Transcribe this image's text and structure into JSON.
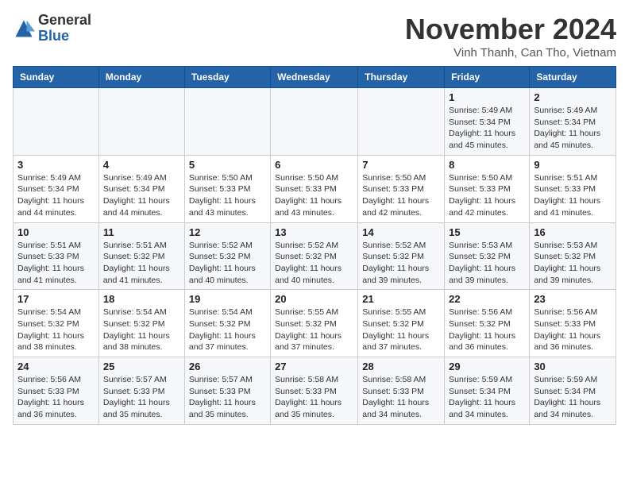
{
  "header": {
    "logo_general": "General",
    "logo_blue": "Blue",
    "month_title": "November 2024",
    "location": "Vinh Thanh, Can Tho, Vietnam"
  },
  "weekdays": [
    "Sunday",
    "Monday",
    "Tuesday",
    "Wednesday",
    "Thursday",
    "Friday",
    "Saturday"
  ],
  "weeks": [
    [
      {
        "day": "",
        "info": ""
      },
      {
        "day": "",
        "info": ""
      },
      {
        "day": "",
        "info": ""
      },
      {
        "day": "",
        "info": ""
      },
      {
        "day": "",
        "info": ""
      },
      {
        "day": "1",
        "info": "Sunrise: 5:49 AM\nSunset: 5:34 PM\nDaylight: 11 hours and 45 minutes."
      },
      {
        "day": "2",
        "info": "Sunrise: 5:49 AM\nSunset: 5:34 PM\nDaylight: 11 hours and 45 minutes."
      }
    ],
    [
      {
        "day": "3",
        "info": "Sunrise: 5:49 AM\nSunset: 5:34 PM\nDaylight: 11 hours and 44 minutes."
      },
      {
        "day": "4",
        "info": "Sunrise: 5:49 AM\nSunset: 5:34 PM\nDaylight: 11 hours and 44 minutes."
      },
      {
        "day": "5",
        "info": "Sunrise: 5:50 AM\nSunset: 5:33 PM\nDaylight: 11 hours and 43 minutes."
      },
      {
        "day": "6",
        "info": "Sunrise: 5:50 AM\nSunset: 5:33 PM\nDaylight: 11 hours and 43 minutes."
      },
      {
        "day": "7",
        "info": "Sunrise: 5:50 AM\nSunset: 5:33 PM\nDaylight: 11 hours and 42 minutes."
      },
      {
        "day": "8",
        "info": "Sunrise: 5:50 AM\nSunset: 5:33 PM\nDaylight: 11 hours and 42 minutes."
      },
      {
        "day": "9",
        "info": "Sunrise: 5:51 AM\nSunset: 5:33 PM\nDaylight: 11 hours and 41 minutes."
      }
    ],
    [
      {
        "day": "10",
        "info": "Sunrise: 5:51 AM\nSunset: 5:33 PM\nDaylight: 11 hours and 41 minutes."
      },
      {
        "day": "11",
        "info": "Sunrise: 5:51 AM\nSunset: 5:32 PM\nDaylight: 11 hours and 41 minutes."
      },
      {
        "day": "12",
        "info": "Sunrise: 5:52 AM\nSunset: 5:32 PM\nDaylight: 11 hours and 40 minutes."
      },
      {
        "day": "13",
        "info": "Sunrise: 5:52 AM\nSunset: 5:32 PM\nDaylight: 11 hours and 40 minutes."
      },
      {
        "day": "14",
        "info": "Sunrise: 5:52 AM\nSunset: 5:32 PM\nDaylight: 11 hours and 39 minutes."
      },
      {
        "day": "15",
        "info": "Sunrise: 5:53 AM\nSunset: 5:32 PM\nDaylight: 11 hours and 39 minutes."
      },
      {
        "day": "16",
        "info": "Sunrise: 5:53 AM\nSunset: 5:32 PM\nDaylight: 11 hours and 39 minutes."
      }
    ],
    [
      {
        "day": "17",
        "info": "Sunrise: 5:54 AM\nSunset: 5:32 PM\nDaylight: 11 hours and 38 minutes."
      },
      {
        "day": "18",
        "info": "Sunrise: 5:54 AM\nSunset: 5:32 PM\nDaylight: 11 hours and 38 minutes."
      },
      {
        "day": "19",
        "info": "Sunrise: 5:54 AM\nSunset: 5:32 PM\nDaylight: 11 hours and 37 minutes."
      },
      {
        "day": "20",
        "info": "Sunrise: 5:55 AM\nSunset: 5:32 PM\nDaylight: 11 hours and 37 minutes."
      },
      {
        "day": "21",
        "info": "Sunrise: 5:55 AM\nSunset: 5:32 PM\nDaylight: 11 hours and 37 minutes."
      },
      {
        "day": "22",
        "info": "Sunrise: 5:56 AM\nSunset: 5:32 PM\nDaylight: 11 hours and 36 minutes."
      },
      {
        "day": "23",
        "info": "Sunrise: 5:56 AM\nSunset: 5:33 PM\nDaylight: 11 hours and 36 minutes."
      }
    ],
    [
      {
        "day": "24",
        "info": "Sunrise: 5:56 AM\nSunset: 5:33 PM\nDaylight: 11 hours and 36 minutes."
      },
      {
        "day": "25",
        "info": "Sunrise: 5:57 AM\nSunset: 5:33 PM\nDaylight: 11 hours and 35 minutes."
      },
      {
        "day": "26",
        "info": "Sunrise: 5:57 AM\nSunset: 5:33 PM\nDaylight: 11 hours and 35 minutes."
      },
      {
        "day": "27",
        "info": "Sunrise: 5:58 AM\nSunset: 5:33 PM\nDaylight: 11 hours and 35 minutes."
      },
      {
        "day": "28",
        "info": "Sunrise: 5:58 AM\nSunset: 5:33 PM\nDaylight: 11 hours and 34 minutes."
      },
      {
        "day": "29",
        "info": "Sunrise: 5:59 AM\nSunset: 5:34 PM\nDaylight: 11 hours and 34 minutes."
      },
      {
        "day": "30",
        "info": "Sunrise: 5:59 AM\nSunset: 5:34 PM\nDaylight: 11 hours and 34 minutes."
      }
    ]
  ]
}
